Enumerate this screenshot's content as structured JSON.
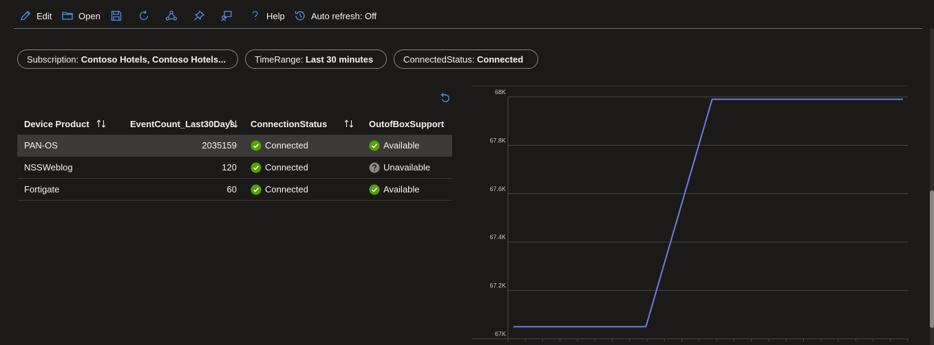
{
  "toolbar": {
    "edit": "Edit",
    "open": "Open",
    "help": "Help",
    "auto_refresh": "Auto refresh: Off",
    "icons": [
      "pencil-icon",
      "folder-icon",
      "save-icon",
      "refresh-icon",
      "share-icon",
      "pin-icon",
      "feedback-icon",
      "help-icon",
      "history-icon"
    ]
  },
  "filters": {
    "subscription": {
      "key": "Subscription:",
      "value": "Contoso Hotels, Contoso Hotels..."
    },
    "time_range": {
      "key": "TimeRange:",
      "value": "Last 30 minutes"
    },
    "connected_status": {
      "key": "ConnectedStatus:",
      "value": "Connected"
    }
  },
  "table": {
    "columns": [
      "Device Product",
      "EventCount_Last30Days",
      "ConnectionStatus",
      "OutofBoxSupport"
    ],
    "rows": [
      {
        "product": "PAN-OS",
        "count": "2035159",
        "status": "Connected",
        "support": "Available",
        "support_state": "ok"
      },
      {
        "product": "NSSWeblog",
        "count": "120",
        "status": "Connected",
        "support": "Unavailable",
        "support_state": "unknown"
      },
      {
        "product": "Fortigate",
        "count": "60",
        "status": "Connected",
        "support": "Available",
        "support_state": "ok"
      }
    ]
  },
  "colors": {
    "ok": "#57a300",
    "unknown": "#8a8886",
    "accent": "#4f8fe8",
    "line": "#6f7ce3"
  },
  "chart_data": {
    "type": "line",
    "y_tick_labels": [
      "67K",
      "67.2K",
      "67.4K",
      "67.6K",
      "67.8K",
      "68K"
    ],
    "ylim": [
      67000,
      68000
    ],
    "grid": true,
    "series": [
      {
        "points": [
          [
            0,
            67050
          ],
          [
            0.34,
            67050
          ],
          [
            0.51,
            67990
          ],
          [
            1.0,
            67990
          ]
        ]
      }
    ]
  }
}
